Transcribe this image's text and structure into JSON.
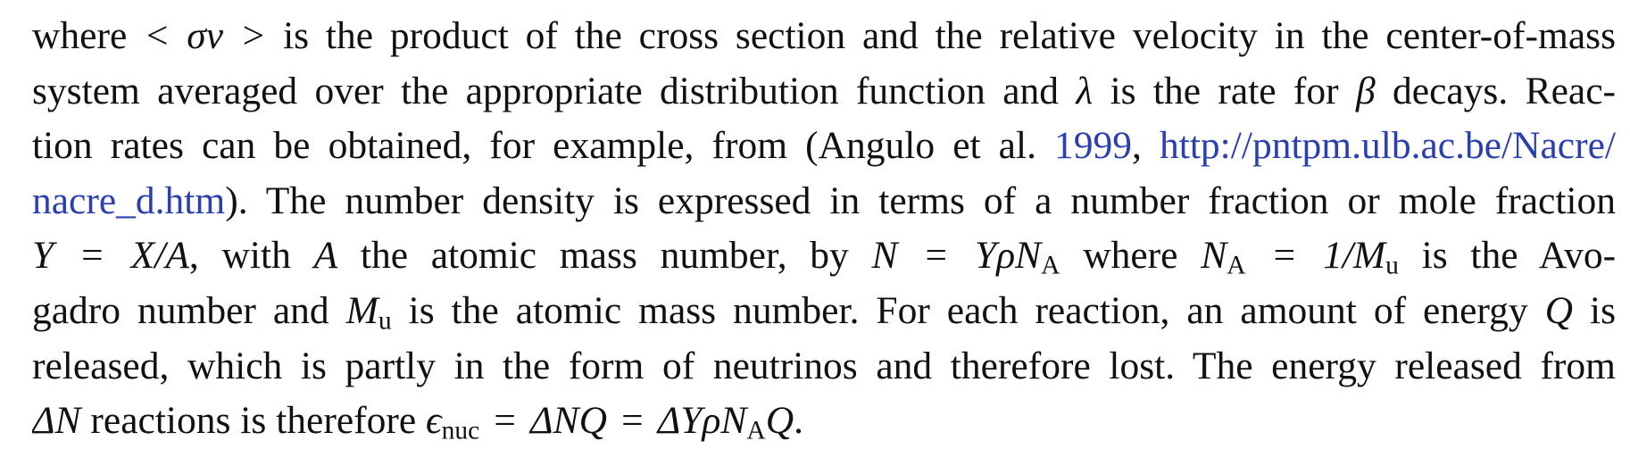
{
  "paragraph": {
    "line1": {
      "t1": "where ",
      "m_sigma_v": "< σv >",
      "t2": " is the product of the cross section and the relative velocity in the center-of-mass"
    },
    "line2": {
      "t1": "system averaged over the appropriate distribution function and ",
      "m_lambda": "λ",
      "t2": " is the rate for ",
      "m_beta": "β",
      "t3": " decays. Reac-"
    },
    "line3": {
      "t1": "tion rates can be obtained, for example, from (Angulo et al. ",
      "ref_year": "1999",
      "t2": ", ",
      "url_part1": "http://pntpm.ulb.ac.be/Nacre/"
    },
    "line4": {
      "url_part2": "nacre_d.htm",
      "t1": "). The number density is expressed in terms of a number fraction or mole fraction"
    },
    "line5": {
      "m_Y": "Y",
      "eq1": "=",
      "m_X_over_A": "X/A",
      "t1": ", with ",
      "m_A": "A",
      "t2": " the atomic mass number, by ",
      "m_N": "N",
      "eq2": "=",
      "m_Yrho": "YρN",
      "sub_A1": "A",
      "t3": " where ",
      "m_N2": "N",
      "sub_A2": "A",
      "eq3": "=",
      "m_one_over": "1/M",
      "sub_u1": "u",
      "t4": " is the Avo-"
    },
    "line6": {
      "t1": "gadro number and ",
      "m_M": "M",
      "sub_u2": "u",
      "t2": " is the atomic mass number. For each reaction, an amount of energy ",
      "m_Q": "Q",
      "t3": " is"
    },
    "line7": {
      "t1": "released, which is partly in the form of neutrinos and therefore lost. The energy released from"
    },
    "line8": {
      "m_deltaN": "ΔN",
      "t1": " reactions is therefore ",
      "m_eps": "ϵ",
      "sub_nuc": "nuc",
      "eq1": "=",
      "m_dNQ": "ΔNQ",
      "eq2": "=",
      "m_dY": "ΔYρN",
      "sub_A3": "A",
      "m_Q2": "Q",
      "t2": "."
    }
  },
  "colors": {
    "text": "#111111",
    "link": "#2a3fb0"
  }
}
